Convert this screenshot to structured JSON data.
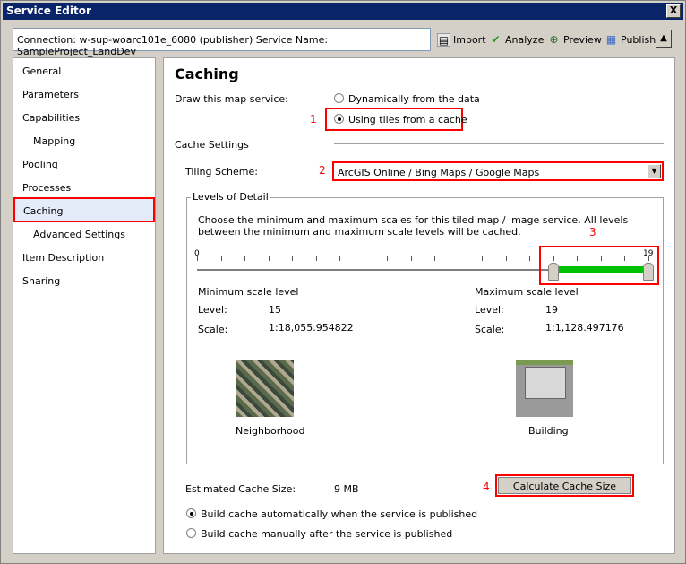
{
  "window": {
    "title": "Service Editor",
    "close": "X"
  },
  "toolbar": {
    "connection": "Connection: w-sup-woarc101e_6080 (publisher)   Service Name: SampleProject_LandDev",
    "import": "Import",
    "analyze": "Analyze",
    "preview": "Preview",
    "publish": "Publish",
    "collapse": "▲"
  },
  "sidebar": {
    "items": [
      {
        "label": "General"
      },
      {
        "label": "Parameters"
      },
      {
        "label": "Capabilities"
      },
      {
        "label": "Mapping"
      },
      {
        "label": "Pooling"
      },
      {
        "label": "Processes"
      },
      {
        "label": "Caching"
      },
      {
        "label": "Advanced Settings"
      },
      {
        "label": "Item Description"
      },
      {
        "label": "Sharing"
      }
    ]
  },
  "main": {
    "title": "Caching",
    "draw_label": "Draw this map service:",
    "draw_options": [
      "Dynamically from the data",
      "Using tiles from a cache"
    ],
    "cache_settings": "Cache Settings",
    "tiling_label": "Tiling Scheme:",
    "tiling_value": "ArcGIS Online / Bing Maps / Google Maps",
    "lod_title": "Levels of Detail",
    "lod_desc": "Choose the minimum and maximum scales for this tiled map / image service. All levels between the minimum and maximum scale levels will be cached.",
    "slider": {
      "min": 0,
      "max": 19,
      "low": 15,
      "high": 19,
      "min_label": "0",
      "max_label": "19"
    },
    "min_block": {
      "title": "Minimum scale level",
      "level_label": "Level:",
      "level": "15",
      "scale_label": "Scale:",
      "scale": "1:18,055.954822",
      "thumb_label": "Neighborhood"
    },
    "max_block": {
      "title": "Maximum scale level",
      "level_label": "Level:",
      "level": "19",
      "scale_label": "Scale:",
      "scale": "1:1,128.497176",
      "thumb_label": "Building"
    },
    "est_label": "Estimated Cache Size:",
    "est_value": "9 MB",
    "calc_button": "Calculate Cache Size",
    "build_options": [
      "Build cache automatically when the service is published",
      "Build cache manually after the service is published"
    ],
    "callouts": [
      "1",
      "2",
      "3",
      "4"
    ]
  },
  "colors": {
    "title_bar": "#0a246a",
    "highlight": "#ff0000",
    "range": "#00c000"
  }
}
